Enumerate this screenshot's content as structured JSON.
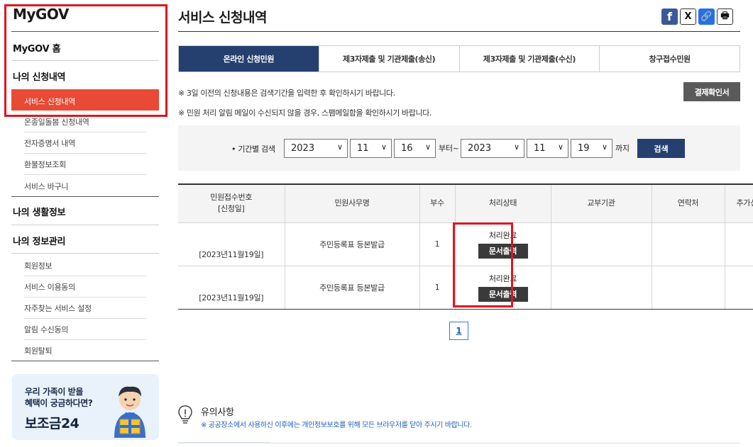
{
  "sidebar": {
    "brand": "MyGOV",
    "home": "MyGOV 홈",
    "section_applications": "나의 신청내역",
    "applications_items": [
      "서비스 신청내역",
      "온종일돌봄 신청내역",
      "전자증명서 내역",
      "환불정보조회",
      "서비스 바구니"
    ],
    "section_life": "나의 생활정보",
    "section_info": "나의 정보관리",
    "info_items": [
      "회원정보",
      "서비스 이용동의",
      "자주찾는 서비스 설정",
      "알림 수신동의",
      "회원탈퇴"
    ],
    "banner": {
      "line1": "우리 가족이 받을",
      "line2": "혜택이 궁금하다면?",
      "line3": "보조금24"
    }
  },
  "main": {
    "title": "서비스 신청내역",
    "share": {
      "facebook": "f",
      "x": "X",
      "link": "🔗",
      "print": "🖶"
    },
    "tabs": [
      "온라인 신청민원",
      "제3자제출 및 기관제출(송신)",
      "제3자제출 및 기관제출(수신)",
      "창구접수민원"
    ],
    "active_tab": 0,
    "note1": "※ 3일 이전의 신청내용은 검색기간을 입력한 후 확인하시기 바랍니다.",
    "note2": "※ 민원 처리 알림 메일이 수신되지 않을 경우, 스팸메일함을 확인하시기 바랍니다.",
    "receipt_button": "결제확인서",
    "search": {
      "label": "• 기간별 검색",
      "from_year": "2023",
      "from_month": "11",
      "from_day": "16",
      "from_suffix": "부터~",
      "to_year": "2023",
      "to_month": "11",
      "to_day": "19",
      "to_suffix": "까지",
      "button": "검색"
    },
    "table": {
      "headers": [
        "민원접수번호\n[신청일]",
        "민원사무명",
        "부수",
        "처리상태",
        "교부기관",
        "연락처",
        "추가신청"
      ],
      "rows": [
        {
          "date": "[2023년11월19일]",
          "name": "주민등록표 등본발급",
          "copies": "1",
          "status": "처리완료",
          "action": "문서출력"
        },
        {
          "date": "[2023년11월19일]",
          "name": "주민등록표 등본발급",
          "copies": "1",
          "status": "처리완료",
          "action": "문서출력"
        }
      ]
    },
    "pagination": [
      "1"
    ],
    "caution": {
      "title": "유의사항",
      "text": "※ 공공장소에서 사용하신 이후에는 개인정보보호를 위해 모든 브라우저를 닫아 주시기 바랍니다."
    }
  },
  "colors": {
    "accent_navy": "#25406e",
    "active_red": "#e84a35",
    "highlight_red": "#e0161f",
    "link_blue": "#1d5fbf"
  }
}
